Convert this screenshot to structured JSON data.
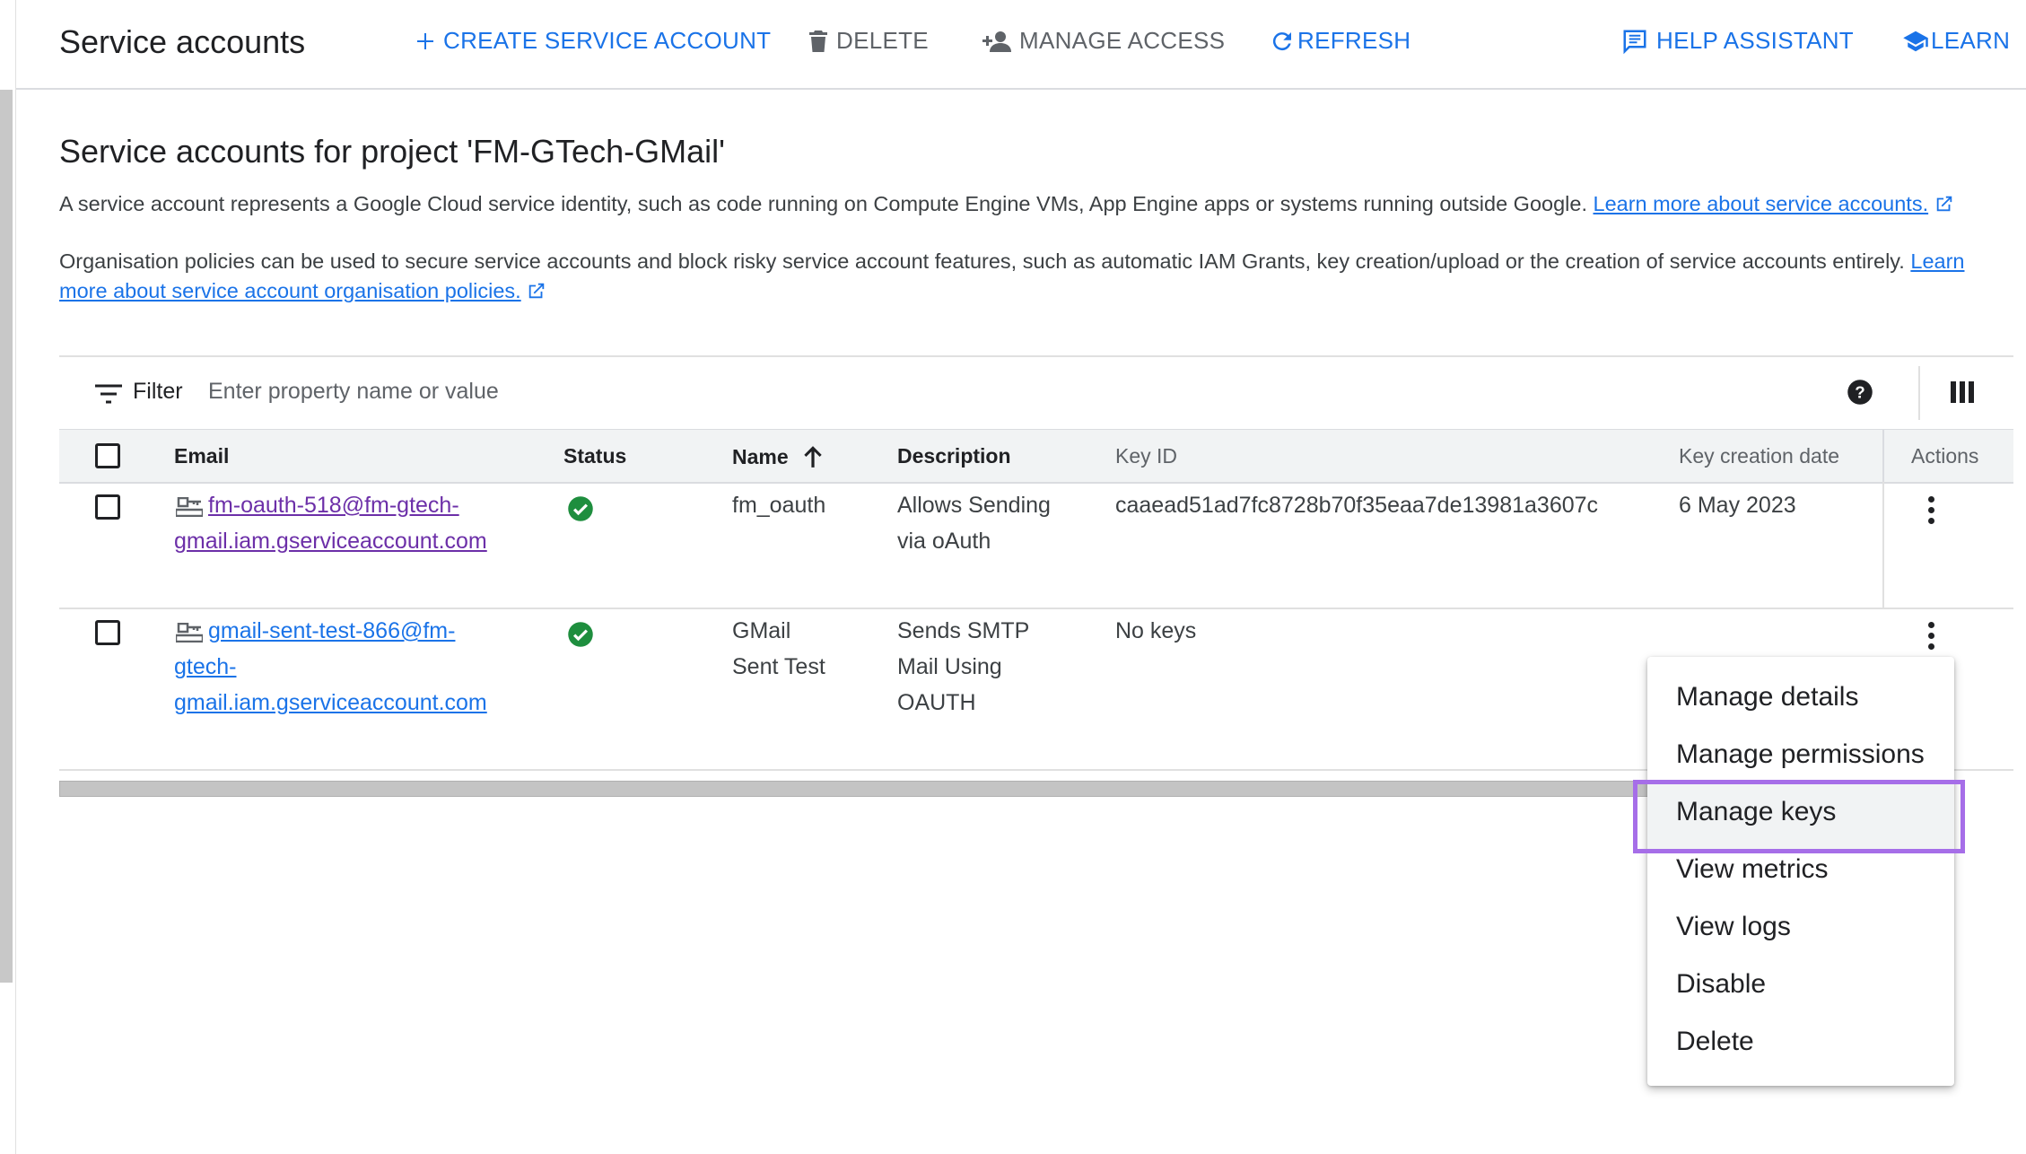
{
  "header": {
    "title": "Service accounts",
    "create_label": "CREATE SERVICE ACCOUNT",
    "delete_label": "DELETE",
    "manage_access_label": "MANAGE ACCESS",
    "refresh_label": "REFRESH",
    "help_label": "HELP ASSISTANT",
    "learn_label": "LEARN"
  },
  "main": {
    "heading": "Service accounts for project 'FM-GTech-GMail'",
    "intro_text": "A service account represents a Google Cloud service identity, such as code running on Compute Engine VMs, App Engine apps or systems running outside Google.",
    "intro_link": "Learn more about service accounts.",
    "policy_text": "Organisation policies can be used to secure service accounts and block risky service account features, such as automatic IAM Grants, key creation/upload or the creation of service accounts entirely.",
    "policy_link_1": "Learn",
    "policy_link_2": "more about service account organisation policies."
  },
  "filter": {
    "label": "Filter",
    "placeholder": "Enter property name or value"
  },
  "table": {
    "columns": {
      "email": "Email",
      "status": "Status",
      "name": "Name",
      "description": "Description",
      "key_id": "Key ID",
      "key_date": "Key creation date",
      "actions": "Actions"
    },
    "rows": [
      {
        "email_1": "fm-oauth-518@fm-gtech-",
        "email_2": "gmail.iam.gserviceaccount.com",
        "status": "enabled",
        "name_1": "fm_oauth",
        "name_2": "",
        "desc_1": "Allows Sending",
        "desc_2": "via oAuth",
        "desc_3": "",
        "key_id": "caaead51ad7fc8728b70f35eaa7de13981a3607c",
        "key_date": "6 May 2023"
      },
      {
        "email_1": "gmail-sent-test-866@fm-",
        "email_2": "gtech-",
        "email_3": "gmail.iam.gserviceaccount.com",
        "status": "enabled",
        "name_1": "GMail",
        "name_2": "Sent Test",
        "desc_1": "Sends SMTP",
        "desc_2": "Mail Using",
        "desc_3": "OAUTH",
        "key_id": "No keys",
        "key_date": ""
      }
    ]
  },
  "menu": {
    "items": [
      "Manage details",
      "Manage permissions",
      "Manage keys",
      "View metrics",
      "View logs",
      "Disable",
      "Delete"
    ],
    "highlighted": "Manage keys"
  },
  "colors": {
    "accent": "#1a73e8",
    "status_ok": "#1e8e3e",
    "visited_link": "#6c2fa8",
    "highlight": "#a66ee8"
  }
}
